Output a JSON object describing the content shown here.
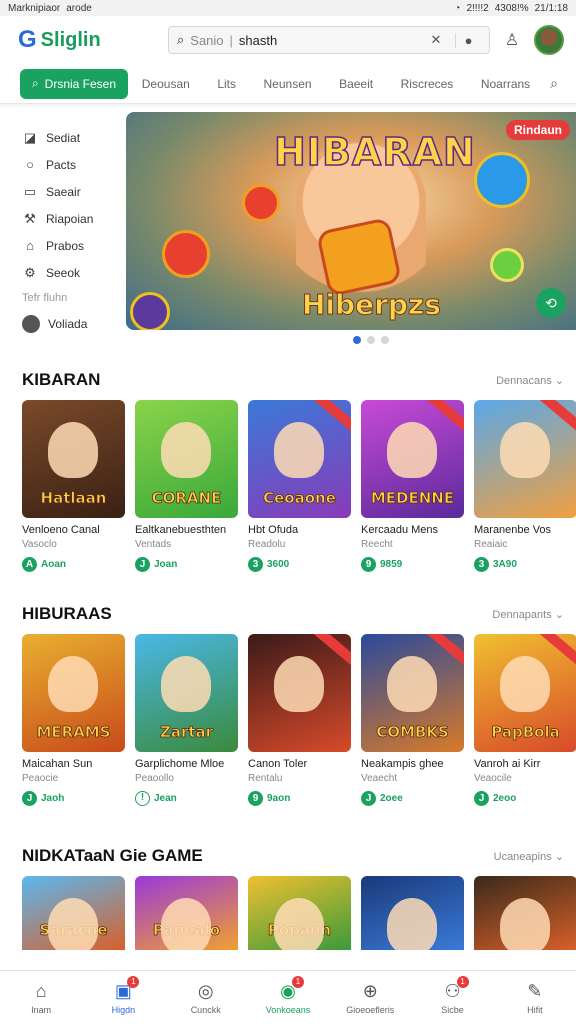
{
  "status_bar": {
    "left": "Marknipiaor",
    "center": "arode",
    "right_1": "2!!!!2",
    "right_2": "4308!%",
    "right_3": "21/1:18"
  },
  "header": {
    "logo": "Sliglin",
    "search": {
      "placeholder": "Sanio",
      "value": "shasth"
    }
  },
  "nav": {
    "primary_button": "Drsnia Fesen",
    "links": [
      "Deousan",
      "Lits",
      "Neunsen",
      "Baeeit",
      "Riscreces",
      "Noarrans"
    ]
  },
  "sidebar": {
    "items": [
      {
        "label": "Sediat",
        "icon": "bookmark-icon"
      },
      {
        "label": "Pacts",
        "icon": "circle-icon"
      },
      {
        "label": "Saeair",
        "icon": "square-icon"
      },
      {
        "label": "Riapoian",
        "icon": "wrench-icon"
      },
      {
        "label": "Prabos",
        "icon": "tag-icon"
      },
      {
        "label": "Seeok",
        "icon": "gear-icon"
      }
    ],
    "heading": "Tefr fluhn",
    "bottom_item": {
      "label": "Voliada",
      "icon": "avatar-icon"
    }
  },
  "banner": {
    "title": "HIBARAN",
    "subtitle": "Hiberpzs",
    "badge": "Rindaun",
    "dots": 3,
    "active_dot": 0
  },
  "sections": [
    {
      "title": "KIBARAN",
      "more": "Dennacans",
      "cards": [
        {
          "thumb_text": "Hatlaan",
          "name": "Venloeno Canal",
          "sub": "Vasoclo",
          "price": "Aoan",
          "price_icon": "A",
          "bg": "#7a4a2a",
          "bg2": "#3a2014"
        },
        {
          "thumb_text": "CORANE",
          "name": "Ealtkanebuesthten",
          "sub": "Ventads",
          "price": "Joan",
          "price_icon": "J",
          "bg": "#8ad44a",
          "bg2": "#3aa83a"
        },
        {
          "thumb_text": "Ceoaone",
          "name": "Hbt Ofuda",
          "sub": "Readolu",
          "price": "3600",
          "price_icon": "3",
          "bg": "#3a7ad8",
          "bg2": "#8a3ab8"
        },
        {
          "thumb_text": "MEDENNE",
          "name": "Kercaadu Mens",
          "sub": "Reecht",
          "price": "9859",
          "price_icon": "9",
          "bg": "#c84ad8",
          "bg2": "#5a2a9a"
        },
        {
          "thumb_text": "",
          "name": "Maranenbe Vos",
          "sub": "Reaiaic",
          "price": "3A90",
          "price_icon": "3",
          "bg": "#5aa8e8",
          "bg2": "#f0a040"
        }
      ]
    },
    {
      "title": "HIBURAAS",
      "more": "Dennapants",
      "cards": [
        {
          "thumb_text": "MERAMS",
          "name": "Maicahan Sun",
          "sub": "Peaocie",
          "price": "Jaoh",
          "price_icon": "J",
          "bg": "#e8b030",
          "bg2": "#c84a1a"
        },
        {
          "thumb_text": "Zartar",
          "name": "Garplichome Mloe",
          "sub": "Peaoollo",
          "price": "Jean",
          "price_icon": "!",
          "bg": "#4ab8e8",
          "bg2": "#3a8a3a",
          "outline": true
        },
        {
          "thumb_text": "",
          "name": "Canon Toler",
          "sub": "Rentalu",
          "price": "9aon",
          "price_icon": "9",
          "bg": "#3a1a1a",
          "bg2": "#d84a2a"
        },
        {
          "thumb_text": "COMBKS",
          "name": "Neakampis ghee",
          "sub": "Veaecht",
          "price": "2oee",
          "price_icon": "J",
          "bg": "#2a4a9a",
          "bg2": "#d87a2a"
        },
        {
          "thumb_text": "PapBola",
          "name": "Vanroh ai Kirr",
          "sub": "Veaocile",
          "price": "2eoo",
          "price_icon": "J",
          "bg": "#f0c030",
          "bg2": "#d84a2a"
        }
      ]
    },
    {
      "title": "NIDKATaaN  Gie GAME",
      "more": "Ucaneapins",
      "cards": [
        {
          "thumb_text": "Saracne",
          "bg": "#5ab8f0",
          "bg2": "#d8602a"
        },
        {
          "thumb_text": "Papealo",
          "bg": "#9a3ad8",
          "bg2": "#f0a030"
        },
        {
          "thumb_text": "Popaon",
          "bg": "#f0c030",
          "bg2": "#3a9a3a"
        },
        {
          "thumb_text": "",
          "bg": "#1a3a7a",
          "bg2": "#3a7ad8"
        },
        {
          "thumb_text": "",
          "bg": "#3a2a1a",
          "bg2": "#d8602a"
        }
      ]
    }
  ],
  "bottom_nav": [
    {
      "label": "Inam",
      "icon": "home-icon",
      "state": "normal",
      "badge": ""
    },
    {
      "label": "Higdn",
      "icon": "tv-icon",
      "state": "active-blue",
      "badge": "1"
    },
    {
      "label": "Cunckk",
      "icon": "compass-icon",
      "state": "normal",
      "badge": ""
    },
    {
      "label": "Vonkoeans",
      "icon": "gamepad-icon",
      "state": "active-green",
      "badge": "1"
    },
    {
      "label": "Gioeoefleris",
      "icon": "globe-icon",
      "state": "normal",
      "badge": ""
    },
    {
      "label": "Sicbe",
      "icon": "people-icon",
      "state": "normal",
      "badge": "1"
    },
    {
      "label": "Hifit",
      "icon": "pencil-icon",
      "state": "normal",
      "badge": ""
    }
  ],
  "colors": {
    "accent_green": "#1aa260",
    "accent_blue": "#2b6ad8",
    "badge_red": "#e63b3b"
  }
}
